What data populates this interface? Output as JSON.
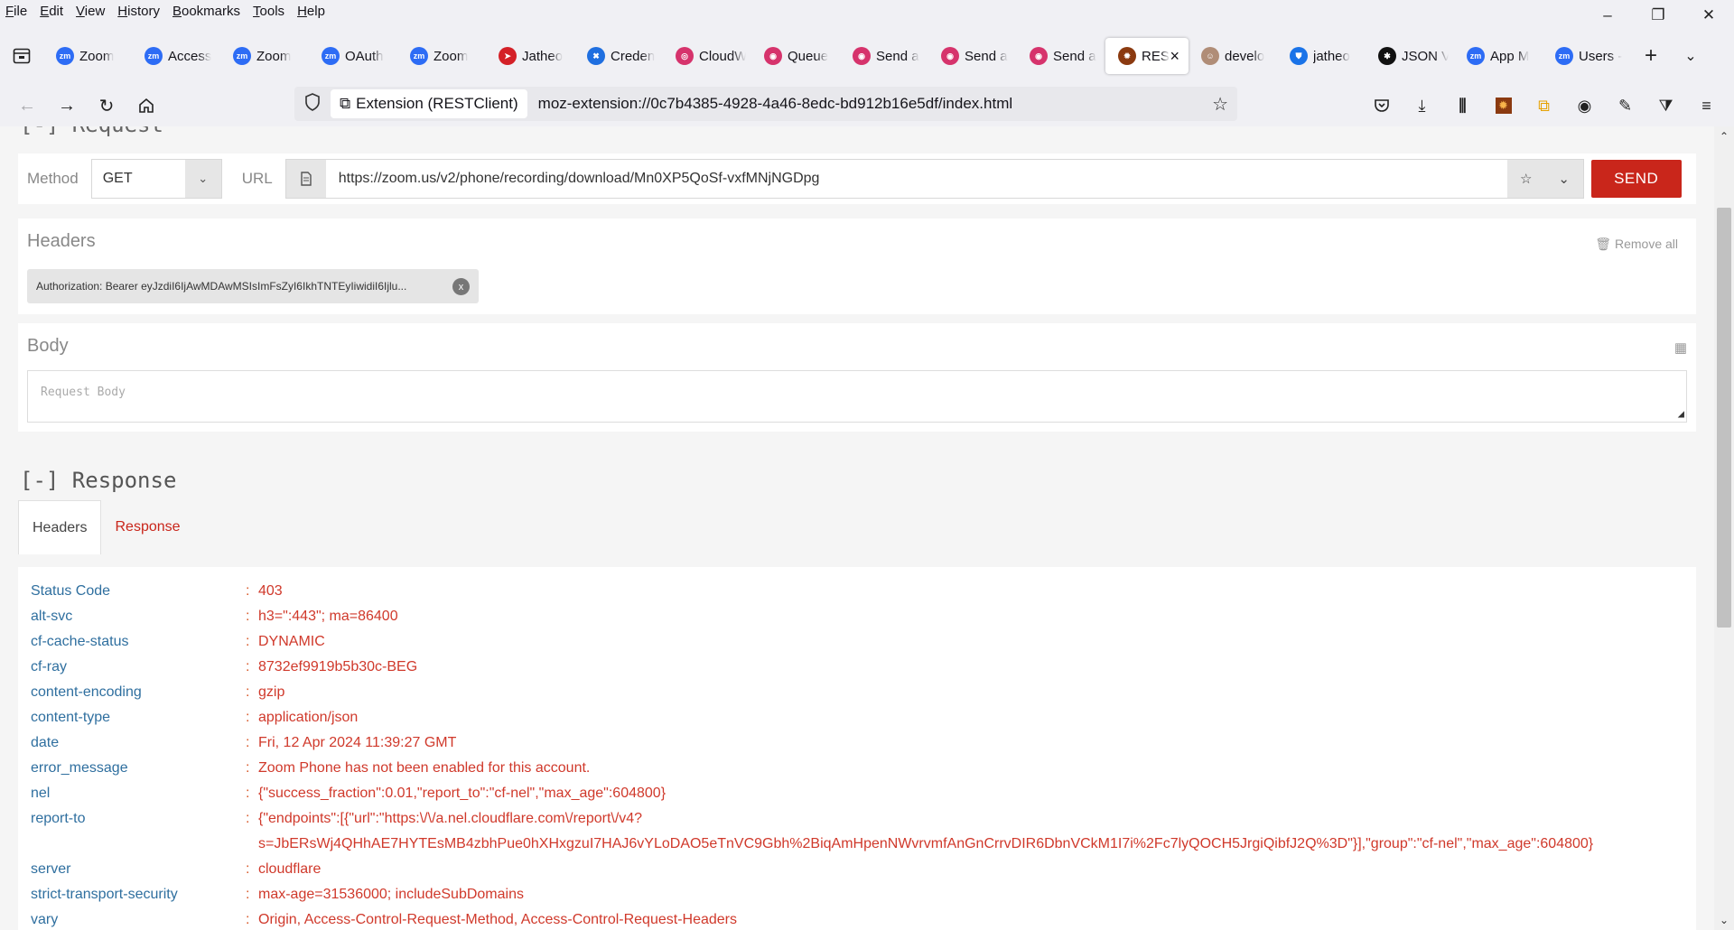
{
  "menu": [
    "File",
    "Edit",
    "View",
    "History",
    "Bookmarks",
    "Tools",
    "Help"
  ],
  "window_controls": {
    "minimize": "–",
    "restore": "❐",
    "close": "✕"
  },
  "tabs": [
    {
      "label": "Zoom",
      "icon": "zoom-icon",
      "color": "#2d6cf5",
      "glyph": "zm"
    },
    {
      "label": "Access",
      "icon": "zoom-icon",
      "color": "#2d6cf5",
      "glyph": "zm"
    },
    {
      "label": "Zoom",
      "icon": "zoom-icon",
      "color": "#2d6cf5",
      "glyph": "zm"
    },
    {
      "label": "OAuth",
      "icon": "zoom-icon",
      "color": "#2d6cf5",
      "glyph": "zm"
    },
    {
      "label": "Zoom",
      "icon": "zoom-icon",
      "color": "#2d6cf5",
      "glyph": "zm"
    },
    {
      "label": "Jatheo",
      "icon": "jatheon-icon",
      "color": "#d42027",
      "glyph": "➤"
    },
    {
      "label": "Creden",
      "icon": "confluence-icon",
      "color": "#1f6fe0",
      "glyph": "✖"
    },
    {
      "label": "CloudW",
      "icon": "cloudwatch-icon",
      "color": "#d6336c",
      "glyph": "◎"
    },
    {
      "label": "Queue",
      "icon": "sqs-icon",
      "color": "#d6336c",
      "glyph": "◉"
    },
    {
      "label": "Send a",
      "icon": "sqs-icon",
      "color": "#d6336c",
      "glyph": "◉"
    },
    {
      "label": "Send a",
      "icon": "sqs-icon",
      "color": "#d6336c",
      "glyph": "◉"
    },
    {
      "label": "Send a",
      "icon": "sqs-icon",
      "color": "#d6336c",
      "glyph": "◉"
    },
    {
      "label": "RES",
      "icon": "restclient-icon",
      "color": "#8b3a10",
      "glyph": "✹",
      "active": true
    },
    {
      "label": "develo",
      "icon": "avatar-icon",
      "color": "#b08d77",
      "glyph": "☺"
    },
    {
      "label": "jatheo",
      "icon": "jatheon-shield-icon",
      "color": "#1a73e8",
      "glyph": "⛊"
    },
    {
      "label": "JSON V",
      "icon": "json-viewer-icon",
      "color": "#111111",
      "glyph": "✱"
    },
    {
      "label": "App M",
      "icon": "zoom-icon",
      "color": "#2d6cf5",
      "glyph": "zm"
    },
    {
      "label": "Users -",
      "icon": "zoom-icon",
      "color": "#2d6cf5",
      "glyph": "zm"
    }
  ],
  "urlbar": {
    "identity": "Extension (RESTClient)",
    "url": "moz-extension://0c7b4385-4928-4a46-8edc-bd912b16e5df/index.html"
  },
  "request": {
    "section_title": "[-] Request",
    "method_label": "Method",
    "method": "GET",
    "url_label": "URL",
    "url": "https://zoom.us/v2/phone/recording/download/Mn0XP5QoSf-vxfMNjNGDpg",
    "send": "SEND",
    "headers_title": "Headers",
    "remove_all": "Remove all",
    "header_chip": "Authorization: Bearer eyJzdiI6IjAwMDAwMSIsImFsZyI6IkhTNTEyIiwidiI6Ijlu...",
    "body_title": "Body",
    "body_placeholder": "Request Body"
  },
  "response": {
    "section_title": "[-] Response",
    "tab_headers": "Headers",
    "tab_response": "Response",
    "rows": [
      {
        "k": "Status Code",
        "v": "403"
      },
      {
        "k": "alt-svc",
        "v": "h3=\":443\"; ma=86400"
      },
      {
        "k": "cf-cache-status",
        "v": "DYNAMIC"
      },
      {
        "k": "cf-ray",
        "v": "8732ef9919b5b30c-BEG"
      },
      {
        "k": "content-encoding",
        "v": "gzip"
      },
      {
        "k": "content-type",
        "v": "application/json"
      },
      {
        "k": "date",
        "v": "Fri, 12 Apr 2024 11:39:27 GMT"
      },
      {
        "k": "error_message",
        "v": "Zoom Phone has not been enabled for this account."
      },
      {
        "k": "nel",
        "v": "{\"success_fraction\":0.01,\"report_to\":\"cf-nel\",\"max_age\":604800}"
      },
      {
        "k": "report-to",
        "v": "{\"endpoints\":[{\"url\":\"https:\\/\\/a.nel.cloudflare.com\\/report\\/v4?",
        "v2": "s=JbERsWj4QHhAE7HYTEsMB4zbhPue0hXHxgzuI7HAJ6vYLoDAO5eTnVC9Gbh%2BiqAmHpenNWvrvmfAnGnCrrvDIR6DbnVCkM1I7i%2Fc7lyQOCH5JrgiQibfJ2Q%3D\"}],\"group\":\"cf-nel\",\"max_age\":604800}"
      },
      {
        "k": "server",
        "v": "cloudflare"
      },
      {
        "k": "strict-transport-security",
        "v": "max-age=31536000; includeSubDomains"
      },
      {
        "k": "vary",
        "v": "Origin, Access-Control-Request-Method, Access-Control-Request-Headers"
      }
    ]
  },
  "colors": {
    "accent": "#c9261b",
    "key": "#2f6f9f",
    "value": "#d0392b"
  }
}
